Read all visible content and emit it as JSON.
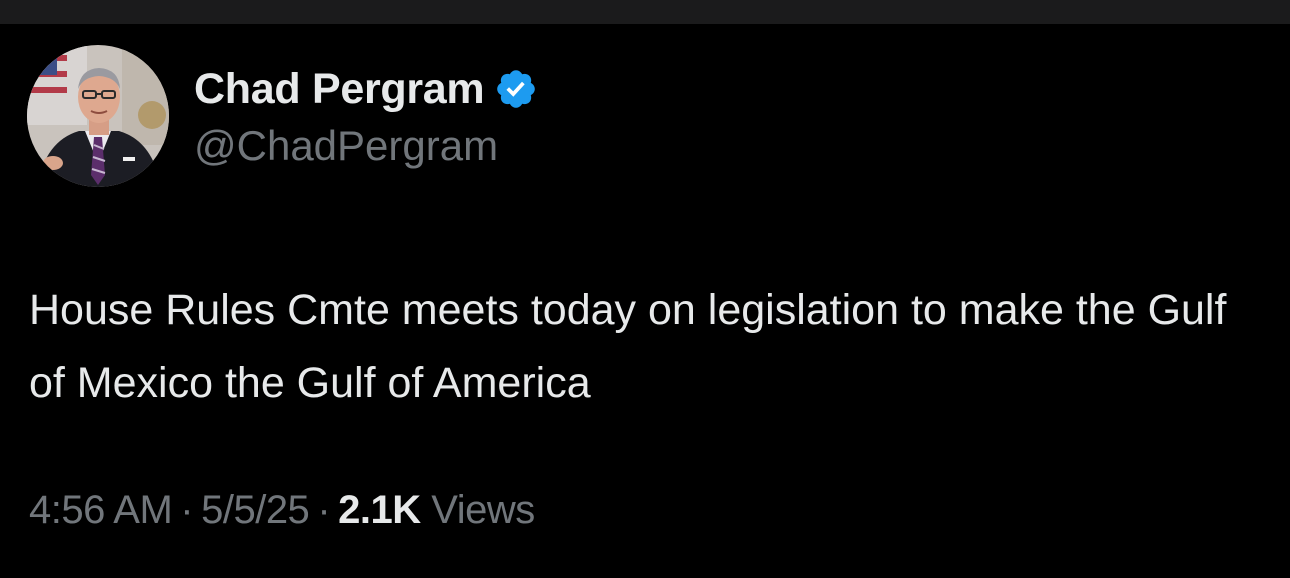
{
  "colors": {
    "background": "#000000",
    "primary_text": "#e7e9ea",
    "secondary_text": "#71767b",
    "verified_badge": "#1d9bf0"
  },
  "author": {
    "display_name": "Chad Pergram",
    "handle": "@ChadPergram",
    "verified_icon": "verified-badge-icon"
  },
  "tweet": {
    "text": "House Rules Cmte meets today on legislation to make the Gulf of Mexico the Gulf of America"
  },
  "meta": {
    "time": "4:56 AM",
    "separator": "·",
    "date": "5/5/25",
    "views_count": "2.1K",
    "views_label": "Views"
  }
}
